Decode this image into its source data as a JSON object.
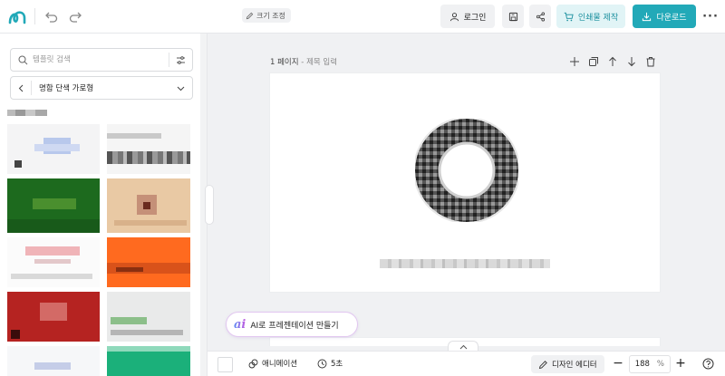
{
  "toolbar": {
    "resize_label": "크기 조정",
    "login_label": "로그인",
    "print_label": "인쇄물 제작",
    "download_label": "다운로드",
    "more_label": "···"
  },
  "sidebar": {
    "search_placeholder": "템플릿 검색",
    "category_label": "명함 단색 가로형"
  },
  "page": {
    "number_label": "1 페이지",
    "separator": " - ",
    "title_placeholder": "제목 입력"
  },
  "ai_button": {
    "badge": "ai",
    "label": "AI로 프레젠테이션 만들기"
  },
  "bottombar": {
    "animation_label": "애니메이션",
    "duration_label": "5초",
    "editor_label": "디자인 에디터",
    "zoom_value": "188",
    "zoom_unit": "%"
  },
  "colors": {
    "accent": "#22a9b8",
    "accent_light": "#e1f4f6",
    "ai_gradient_start": "#5b8cf4",
    "ai_gradient_end": "#c35be0"
  },
  "icons": [
    "logo-icon",
    "undo-icon",
    "redo-icon",
    "pencil-icon",
    "user-icon",
    "save-icon",
    "share-icon",
    "cart-icon",
    "download-icon",
    "search-icon",
    "filter-icon",
    "chevron-left-icon",
    "chevron-down-icon",
    "plus-icon",
    "duplicate-icon",
    "arrow-up-icon",
    "arrow-down-icon",
    "trash-icon",
    "animation-icon",
    "clock-icon",
    "pen-icon",
    "help-icon"
  ]
}
